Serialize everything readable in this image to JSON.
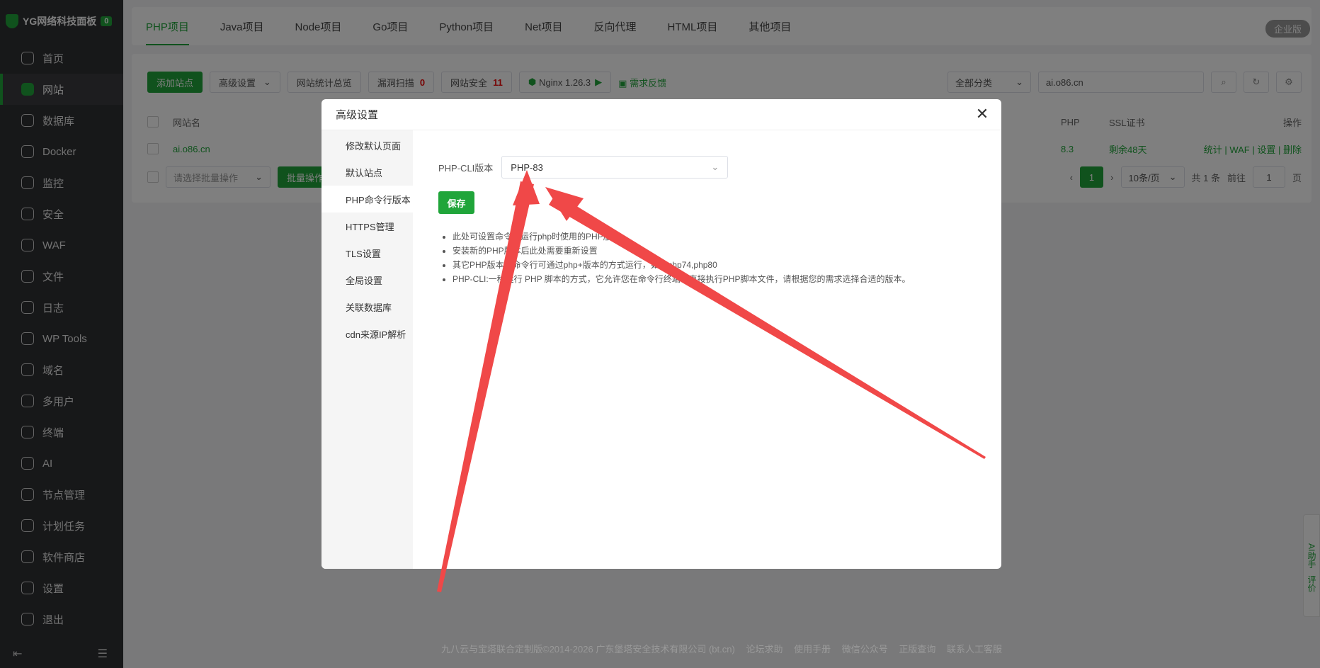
{
  "brand": {
    "name": "YG网络科技面板",
    "badge": "0"
  },
  "sidebar": {
    "items": [
      {
        "label": "首页",
        "icon": "home-icon"
      },
      {
        "label": "网站",
        "icon": "website-icon"
      },
      {
        "label": "数据库",
        "icon": "database-icon"
      },
      {
        "label": "Docker",
        "icon": "docker-icon"
      },
      {
        "label": "监控",
        "icon": "monitor-icon"
      },
      {
        "label": "安全",
        "icon": "shield-icon"
      },
      {
        "label": "WAF",
        "icon": "waf-icon"
      },
      {
        "label": "文件",
        "icon": "folder-icon"
      },
      {
        "label": "日志",
        "icon": "log-icon"
      },
      {
        "label": "WP Tools",
        "icon": "wordpress-icon"
      },
      {
        "label": "域名",
        "icon": "globe-icon"
      },
      {
        "label": "多用户",
        "icon": "users-icon"
      },
      {
        "label": "终端",
        "icon": "terminal-icon"
      },
      {
        "label": "AI",
        "icon": "ai-icon"
      },
      {
        "label": "节点管理",
        "icon": "node-icon"
      },
      {
        "label": "计划任务",
        "icon": "calendar-icon"
      },
      {
        "label": "软件商店",
        "icon": "store-icon"
      },
      {
        "label": "设置",
        "icon": "gear-icon"
      },
      {
        "label": "退出",
        "icon": "logout-icon"
      }
    ]
  },
  "top_tabs": [
    "PHP项目",
    "Java项目",
    "Node项目",
    "Go项目",
    "Python项目",
    "Net项目",
    "反向代理",
    "HTML项目",
    "其他项目"
  ],
  "enterprise_label": "企业版",
  "toolbar": {
    "add_site": "添加站点",
    "advanced": "高级设置",
    "stats": "网站统计总览",
    "scan": "漏洞扫描",
    "scan_count": "0",
    "security": "网站安全",
    "security_count": "11",
    "nginx": "Nginx 1.26.3",
    "feedback": "需求反馈",
    "category": "全部分类",
    "search_value": "ai.o86.cn"
  },
  "table": {
    "headers": {
      "name": "网站名",
      "php": "PHP",
      "ssl": "SSL证书",
      "ops": "操作"
    },
    "row": {
      "name": "ai.o86.cn",
      "php": "8.3",
      "ssl": "剩余48天",
      "ops": [
        "统计",
        "WAF",
        "设置",
        "删除"
      ]
    },
    "batch_placeholder": "请选择批量操作",
    "batch_btn": "批量操作",
    "page": "1",
    "per_page": "10条/页",
    "total": "共 1 条",
    "goto": "前往",
    "goto_value": "1",
    "page_suffix": "页"
  },
  "modal": {
    "title": "高级设置",
    "menu": [
      "修改默认页面",
      "默认站点",
      "PHP命令行版本",
      "HTTPS管理",
      "TLS设置",
      "全局设置",
      "关联数据库",
      "cdn来源IP解析"
    ],
    "active_index": 2,
    "field_label": "PHP-CLI版本",
    "field_value": "PHP-83",
    "save": "保存",
    "tips": [
      "此处可设置命令行运行php时使用的PHP版本",
      "安装新的PHP版本后此处需要重新设置",
      "其它PHP版本在命令行可通过php+版本的方式运行，如：php74,php80",
      "PHP-CLI:一种运行 PHP 脚本的方式，它允许您在命令行终端中直接执行PHP脚本文件，请根据您的需求选择合适的版本。"
    ]
  },
  "footer": {
    "copyright": "九八云与宝塔联合定制版©2014-2026 广东堡塔安全技术有限公司 (bt.cn)",
    "links": [
      "论坛求助",
      "使用手册",
      "微信公众号",
      "正版查询",
      "联系人工客服"
    ]
  },
  "float_ai": {
    "ai": "AI助手",
    "rate": "评价"
  },
  "colors": {
    "accent": "#20a53a",
    "sidebar_bg": "#2f3033",
    "arrow": "#f04848"
  }
}
